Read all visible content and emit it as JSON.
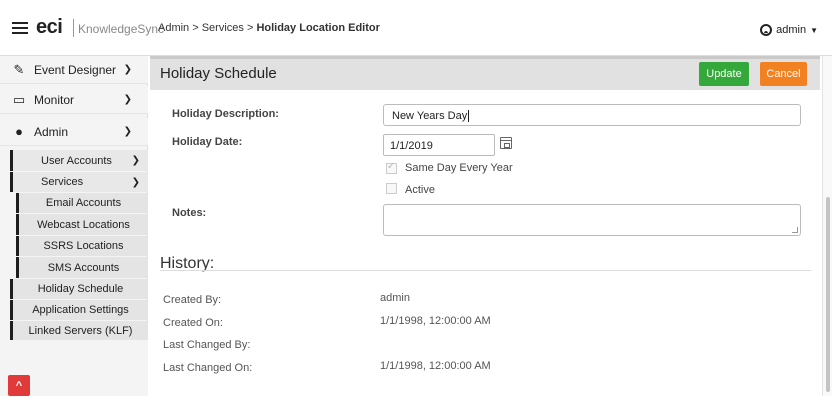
{
  "header": {
    "logo": "eci",
    "logo_sub": "KnowledgeSync",
    "breadcrumb_prefix": "Admin > Services > ",
    "breadcrumb_current": "Holiday Location Editor",
    "user_label": "admin"
  },
  "sidebar": {
    "top_items": [
      {
        "label": "Event Designer",
        "icon": "edit-icon"
      },
      {
        "label": "Monitor",
        "icon": "monitor-icon"
      },
      {
        "label": "Admin",
        "icon": "user-icon"
      }
    ],
    "admin_items": {
      "user_accounts": "User Accounts",
      "services": "Services",
      "email_accounts": "Email Accounts",
      "webcast_locations": "Webcast Locations",
      "ssrs_locations": "SSRS Locations",
      "sms_accounts": "SMS Accounts",
      "holiday_schedule": "Holiday Schedule",
      "application_settings": "Application Settings",
      "linked_servers": "Linked Servers (KLF)"
    }
  },
  "panel": {
    "title": "Holiday Schedule",
    "update_label": "Update",
    "cancel_label": "Cancel"
  },
  "form": {
    "description_label": "Holiday Description:",
    "description_value": "New Years Day",
    "date_label": "Holiday Date:",
    "date_value": "1/1/2019",
    "same_day_label": "Same Day Every Year",
    "same_day_checked": true,
    "active_label": "Active",
    "active_checked": false,
    "notes_label": "Notes:",
    "notes_value": ""
  },
  "history": {
    "title": "History:",
    "rows": [
      {
        "label": "Created By:",
        "value": "admin"
      },
      {
        "label": "Created On:",
        "value": "1/1/1998, 12:00:00 AM"
      },
      {
        "label": "Last Changed By:",
        "value": ""
      },
      {
        "label": "Last Changed On:",
        "value": "1/1/1998, 12:00:00 AM"
      }
    ]
  },
  "colors": {
    "update": "#34a83b",
    "cancel": "#f28122",
    "scroll_top": "#e03a3a"
  }
}
